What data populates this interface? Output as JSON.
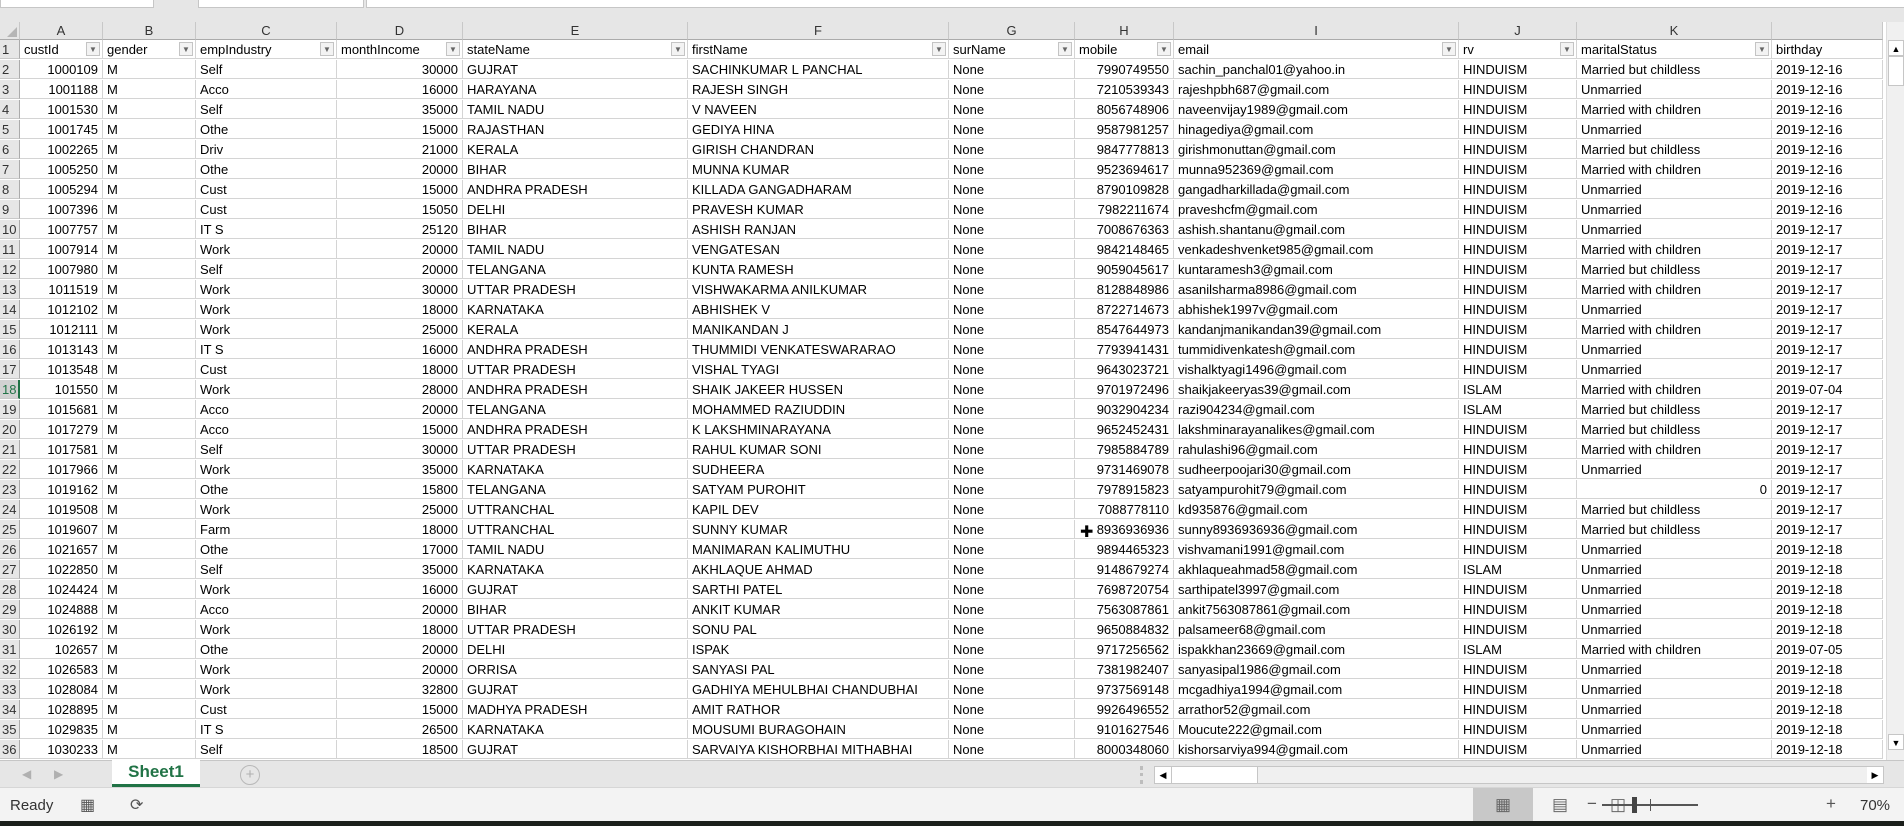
{
  "columns": {
    "letters": [
      "A",
      "B",
      "C",
      "D",
      "E",
      "F",
      "G",
      "H",
      "I",
      "J",
      "K",
      ""
    ],
    "headers": [
      "custId",
      "gender",
      "empIndustry",
      "monthIncome",
      "stateName",
      "firstName",
      "surName",
      "mobile",
      "email",
      "rv",
      "maritalStatus",
      "birthday"
    ],
    "numeric": [
      true,
      false,
      false,
      true,
      false,
      false,
      false,
      true,
      false,
      false,
      false,
      false
    ]
  },
  "selected_row": 18,
  "rows": [
    [
      "1000109",
      "M",
      "Self",
      "30000",
      "GUJRAT",
      "SACHINKUMAR L PANCHAL",
      "None",
      "7990749550",
      "sachin_panchal01@yahoo.in",
      "HINDUISM",
      "Married but childless",
      "2019-12-16"
    ],
    [
      "1001188",
      "M",
      "Acco",
      "16000",
      "HARAYANA",
      "RAJESH SINGH",
      "None",
      "7210539343",
      "rajeshpbh687@gmail.com",
      "HINDUISM",
      "Unmarried",
      "2019-12-16"
    ],
    [
      "1001530",
      "M",
      "Self",
      "35000",
      "TAMIL NADU",
      "V NAVEEN",
      "None",
      "8056748906",
      "naveenvijay1989@gmail.com",
      "HINDUISM",
      "Married with children",
      "2019-12-16"
    ],
    [
      "1001745",
      "M",
      "Othe",
      "15000",
      "RAJASTHAN",
      "GEDIYA HINA",
      "None",
      "9587981257",
      "hinagediya@gmail.com",
      "HINDUISM",
      "Unmarried",
      "2019-12-16"
    ],
    [
      "1002265",
      "M",
      "Driv",
      "21000",
      "KERALA",
      "GIRISH CHANDRAN",
      "None",
      "9847778813",
      "girishmonuttan@gmail.com",
      "HINDUISM",
      "Married but childless",
      "2019-12-16"
    ],
    [
      "1005250",
      "M",
      "Othe",
      "20000",
      "BIHAR",
      "MUNNA KUMAR",
      "None",
      "9523694617",
      "munna952369@gmail.com",
      "HINDUISM",
      "Married with children",
      "2019-12-16"
    ],
    [
      "1005294",
      "M",
      "Cust",
      "15000",
      "ANDHRA PRADESH",
      "KILLADA GANGADHARAM",
      "None",
      "8790109828",
      "gangadharkillada@gmail.com",
      "HINDUISM",
      "Unmarried",
      "2019-12-16"
    ],
    [
      "1007396",
      "M",
      "Cust",
      "15050",
      "DELHI",
      "PRAVESH KUMAR",
      "None",
      "7982211674",
      "praveshcfm@gmail.com",
      "HINDUISM",
      "Unmarried",
      "2019-12-16"
    ],
    [
      "1007757",
      "M",
      "IT S",
      "25120",
      "BIHAR",
      "ASHISH RANJAN",
      "None",
      "7008676363",
      "ashish.shantanu@gmail.com",
      "HINDUISM",
      "Unmarried",
      "2019-12-17"
    ],
    [
      "1007914",
      "M",
      "Work",
      "20000",
      "TAMIL NADU",
      "VENGATESAN",
      "None",
      "9842148465",
      "venkadeshvenket985@gmail.com",
      "HINDUISM",
      "Married with children",
      "2019-12-17"
    ],
    [
      "1007980",
      "M",
      "Self",
      "20000",
      "TELANGANA",
      "KUNTA RAMESH",
      "None",
      "9059045617",
      "kuntaramesh3@gmail.com",
      "HINDUISM",
      "Married but childless",
      "2019-12-17"
    ],
    [
      "1011519",
      "M",
      "Work",
      "30000",
      "UTTAR PRADESH",
      "VISHWAKARMA ANILKUMAR",
      "None",
      "8128848986",
      "asanilsharma8986@gmail.com",
      "HINDUISM",
      "Married with children",
      "2019-12-17"
    ],
    [
      "1012102",
      "M",
      "Work",
      "18000",
      "KARNATAKA",
      "ABHISHEK V",
      "None",
      "8722714673",
      "abhishek1997v@gmail.com",
      "HINDUISM",
      "Unmarried",
      "2019-12-17"
    ],
    [
      "1012111",
      "M",
      "Work",
      "25000",
      "KERALA",
      "MANIKANDAN J",
      "None",
      "8547644973",
      "kandanjmanikandan39@gmail.com",
      "HINDUISM",
      "Married with children",
      "2019-12-17"
    ],
    [
      "1013143",
      "M",
      "IT S",
      "16000",
      "ANDHRA PRADESH",
      "THUMMIDI VENKATESWARARAO",
      "None",
      "7793941431",
      "tummidivenkatesh@gmail.com",
      "HINDUISM",
      "Unmarried",
      "2019-12-17"
    ],
    [
      "1013548",
      "M",
      "Cust",
      "18000",
      "UTTAR PRADESH",
      "VISHAL TYAGI",
      "None",
      "9643023721",
      "vishalktyagi1496@gmail.com",
      "HINDUISM",
      "Unmarried",
      "2019-12-17"
    ],
    [
      "101550",
      "M",
      "Work",
      "28000",
      "ANDHRA PRADESH",
      "SHAIK JAKEER HUSSEN",
      "None",
      "9701972496",
      "shaikjakeeryas39@gmail.com",
      "ISLAM",
      "Married with children",
      "2019-07-04"
    ],
    [
      "1015681",
      "M",
      "Acco",
      "20000",
      "TELANGANA",
      "MOHAMMED RAZIUDDIN",
      "None",
      "9032904234",
      "razi904234@gmail.com",
      "ISLAM",
      "Married but childless",
      "2019-12-17"
    ],
    [
      "1017279",
      "M",
      "Acco",
      "15000",
      "ANDHRA PRADESH",
      "K LAKSHMINARAYANA",
      "None",
      "9652452431",
      "lakshminarayanalikes@gmail.com",
      "HINDUISM",
      "Married but childless",
      "2019-12-17"
    ],
    [
      "1017581",
      "M",
      "Self",
      "30000",
      "UTTAR PRADESH",
      "RAHUL KUMAR SONI",
      "None",
      "7985884789",
      "rahulashi96@gmail.com",
      "HINDUISM",
      "Married with children",
      "2019-12-17"
    ],
    [
      "1017966",
      "M",
      "Work",
      "35000",
      "KARNATAKA",
      "SUDHEERA",
      "None",
      "9731469078",
      "sudheerpoojari30@gmail.com",
      "HINDUISM",
      "Unmarried",
      "2019-12-17"
    ],
    [
      "1019162",
      "M",
      "Othe",
      "15800",
      "TELANGANA",
      "SATYAM PUROHIT",
      "None",
      "7978915823",
      "satyampurohit79@gmail.com",
      "HINDUISM",
      "0",
      "2019-12-17"
    ],
    [
      "1019508",
      "M",
      "Work",
      "25000",
      "UTTRANCHAL",
      "KAPIL DEV",
      "None",
      "7088778110",
      "kd935876@gmail.com",
      "HINDUISM",
      "Married but childless",
      "2019-12-17"
    ],
    [
      "1019607",
      "M",
      "Farm",
      "18000",
      "UTTRANCHAL",
      "SUNNY KUMAR",
      "None",
      "8936936936",
      "sunny8936936936@gmail.com",
      "HINDUISM",
      "Married but childless",
      "2019-12-17"
    ],
    [
      "1021657",
      "M",
      "Othe",
      "17000",
      "TAMIL NADU",
      "MANIMARAN KALIMUTHU",
      "None",
      "9894465323",
      "vishvamani1991@gmail.com",
      "HINDUISM",
      "Unmarried",
      "2019-12-18"
    ],
    [
      "1022850",
      "M",
      "Self",
      "35000",
      "KARNATAKA",
      "AKHLAQUE AHMAD",
      "None",
      "9148679274",
      "akhlaqueahmad58@gmail.com",
      "ISLAM",
      "Unmarried",
      "2019-12-18"
    ],
    [
      "1024424",
      "M",
      "Work",
      "16000",
      "GUJRAT",
      "SARTHI PATEL",
      "None",
      "7698720754",
      "sarthipatel3997@gmail.com",
      "HINDUISM",
      "Unmarried",
      "2019-12-18"
    ],
    [
      "1024888",
      "M",
      "Acco",
      "20000",
      "BIHAR",
      "ANKIT KUMAR",
      "None",
      "7563087861",
      "ankit7563087861@gmail.com",
      "HINDUISM",
      "Unmarried",
      "2019-12-18"
    ],
    [
      "1026192",
      "M",
      "Work",
      "18000",
      "UTTAR PRADESH",
      "SONU PAL",
      "None",
      "9650884832",
      "palsameer68@gmail.com",
      "HINDUISM",
      "Unmarried",
      "2019-12-18"
    ],
    [
      "102657",
      "M",
      "Othe",
      "20000",
      "DELHI",
      "ISPAK",
      "None",
      "9717256562",
      "ispakkhan23669@gmail.com",
      "ISLAM",
      "Married with children",
      "2019-07-05"
    ],
    [
      "1026583",
      "M",
      "Work",
      "20000",
      "ORRISA",
      "SANYASI PAL",
      "None",
      "7381982407",
      "sanyasipal1986@gmail.com",
      "HINDUISM",
      "Unmarried",
      "2019-12-18"
    ],
    [
      "1028084",
      "M",
      "Work",
      "32800",
      "GUJRAT",
      "GADHIYA MEHULBHAI CHANDUBHAI",
      "None",
      "9737569148",
      "mcgadhiya1994@gmail.com",
      "HINDUISM",
      "Unmarried",
      "2019-12-18"
    ],
    [
      "1028895",
      "M",
      "Cust",
      "15000",
      "MADHYA PRADESH",
      "AMIT RATHOR",
      "None",
      "9926496552",
      "arrathor52@gmail.com",
      "HINDUISM",
      "Unmarried",
      "2019-12-18"
    ],
    [
      "1029835",
      "M",
      "IT S",
      "26500",
      "KARNATAKA",
      "MOUSUMI BURAGOHAIN",
      "None",
      "9101627546",
      "Moucute222@gmail.com",
      "HINDUISM",
      "Unmarried",
      "2019-12-18"
    ],
    [
      "1030233",
      "M",
      "Self",
      "18500",
      "GUJRAT",
      "SARVAIYA KISHORBHAI MITHABHAI",
      "None",
      "8000348060",
      "kishorsarviya994@gmail.com",
      "HINDUISM",
      "Unmarried",
      "2019-12-18"
    ]
  ],
  "sheet_tabs": [
    {
      "label": "Sheet1",
      "active": true
    }
  ],
  "add_sheet_label": "+",
  "status": {
    "ready": "Ready",
    "zoom_label": "70%",
    "zoom_percent": 70,
    "zoom_minus": "−",
    "zoom_plus": "+"
  },
  "icons": {
    "filter": "▼",
    "scroll_up": "▲",
    "scroll_down": "▼",
    "scroll_left": "◀",
    "scroll_right": "▶",
    "nav_prev": "◀",
    "nav_next": "▶"
  },
  "colors": {
    "accent": "#217346",
    "header_bg": "#e6e6e6",
    "gridline": "#d4d4d4"
  }
}
